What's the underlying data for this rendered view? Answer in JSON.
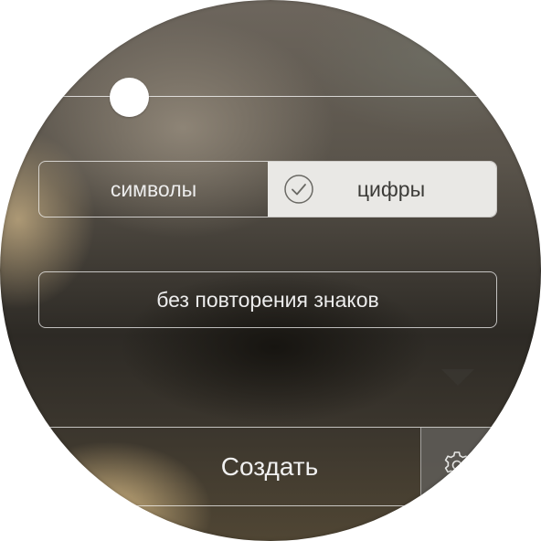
{
  "length_slider": {
    "level": 0.2
  },
  "charset_selector": {
    "options": [
      {
        "label": "символы",
        "selected": false
      },
      {
        "label": "цифры",
        "selected": true
      }
    ],
    "selected_icon": "check-circle-icon"
  },
  "options": {
    "no_repeat_label": "без повторения знаков"
  },
  "action_bar": {
    "create_label": "Создать",
    "settings_icon": "gear-icon"
  },
  "colors": {
    "selected_segment_bg": "#e9e8e5",
    "selected_segment_text": "#3c3b38",
    "text_light": "#ececec"
  }
}
